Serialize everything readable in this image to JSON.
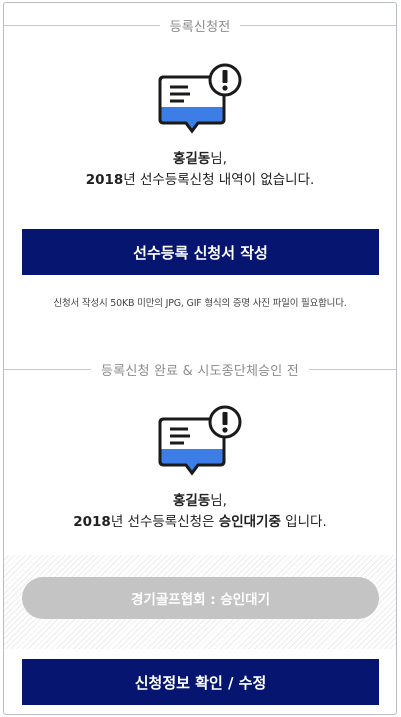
{
  "before": {
    "divider_label": "등록신청전",
    "user_name": "홍길동",
    "honorific": "님,",
    "year": "2018",
    "msg_line2_rest": "년 선수등록신청 내역이 없습니다.",
    "button_label": "선수등록 신청서 작성",
    "note": "신청서 작성시 50KB 미만의 JPG, GIF 형식의 증명 사진 파일이 필요합니다."
  },
  "pending": {
    "divider_label": "등록신청 완료 & 시도종단체승인 전",
    "user_name": "홍길동",
    "honorific": "님,",
    "year": "2018",
    "msg_mid": "년 선수등록신청은 ",
    "status_text": "승인대기중",
    "msg_end": " 입니다.",
    "status_pill": "경기골프협회 : 승인대기",
    "button_label": "신청정보 확인 / 수정"
  },
  "icons": {
    "message_alert": "message-alert-icon"
  },
  "colors": {
    "primary": "#061670",
    "icon_fill": "#3d7ee6",
    "pill": "#c4c4c4"
  }
}
